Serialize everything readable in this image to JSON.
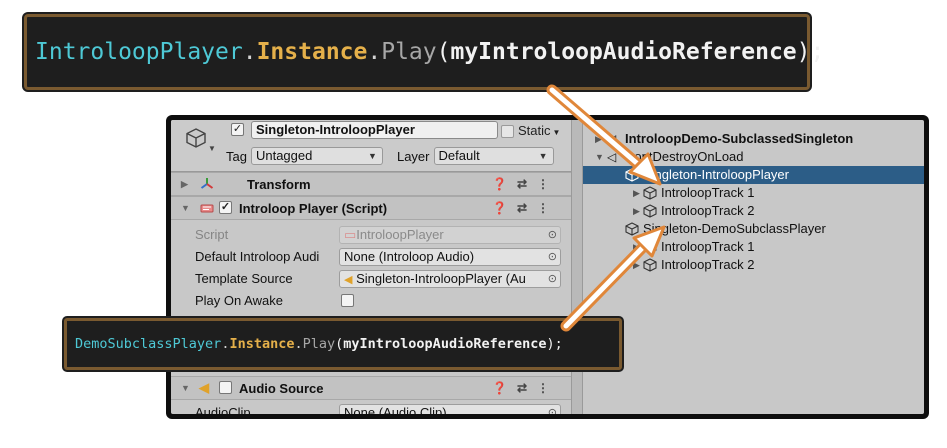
{
  "code_top": {
    "class_name": "IntroloopPlayer",
    "dot1": ".",
    "property": "Instance",
    "dot2": ".",
    "method": "Play",
    "open": "(",
    "argument": "myIntroloopAudioReference",
    "close": ");"
  },
  "code_bottom": {
    "class_name": "DemoSubclassPlayer",
    "dot1": ".",
    "property": "Instance",
    "dot2": ".",
    "method": "Play",
    "open": "(",
    "argument": "myIntroloopAudioReference",
    "close": ");"
  },
  "inspector": {
    "gameobject_name": "Singleton-IntroloopPlayer",
    "active_check": "✓",
    "static_label": "Static",
    "tag_label": "Tag",
    "tag_value": "Untagged",
    "layer_label": "Layer",
    "layer_value": "Default",
    "transform": {
      "title": "Transform"
    },
    "introloop_player": {
      "title": "Introloop Player (Script)",
      "enabled_check": "✓",
      "props": [
        {
          "label": "Script",
          "value": "IntroloopPlayer"
        },
        {
          "label": "Default Introloop Audi",
          "value": "None (Introloop Audio)"
        },
        {
          "label": "Template Source",
          "value": "Singleton-IntroloopPlayer (Au"
        },
        {
          "label": "Play On Awake",
          "value": ""
        }
      ]
    },
    "audio_source": {
      "title": "Audio Source",
      "props": [
        {
          "label": "AudioClip",
          "value": "None (Audio Clip)"
        }
      ]
    }
  },
  "hierarchy": {
    "rows": [
      {
        "label": "IntroloopDemo-SubclassedSingleton"
      },
      {
        "label": "DontDestroyOnLoad"
      },
      {
        "label": "Singleton-IntroloopPlayer"
      },
      {
        "label": "IntroloopTrack 1"
      },
      {
        "label": "IntroloopTrack 2"
      },
      {
        "label": "Singleton-DemoSubclassPlayer"
      },
      {
        "label": "IntroloopTrack 1"
      },
      {
        "label": "IntroloopTrack 2"
      }
    ]
  },
  "colors": {
    "selection": "#2c5d87",
    "arrow_fill": "#ffffff",
    "arrow_outline": "#e0873a",
    "code_border": "#7a5a30"
  }
}
